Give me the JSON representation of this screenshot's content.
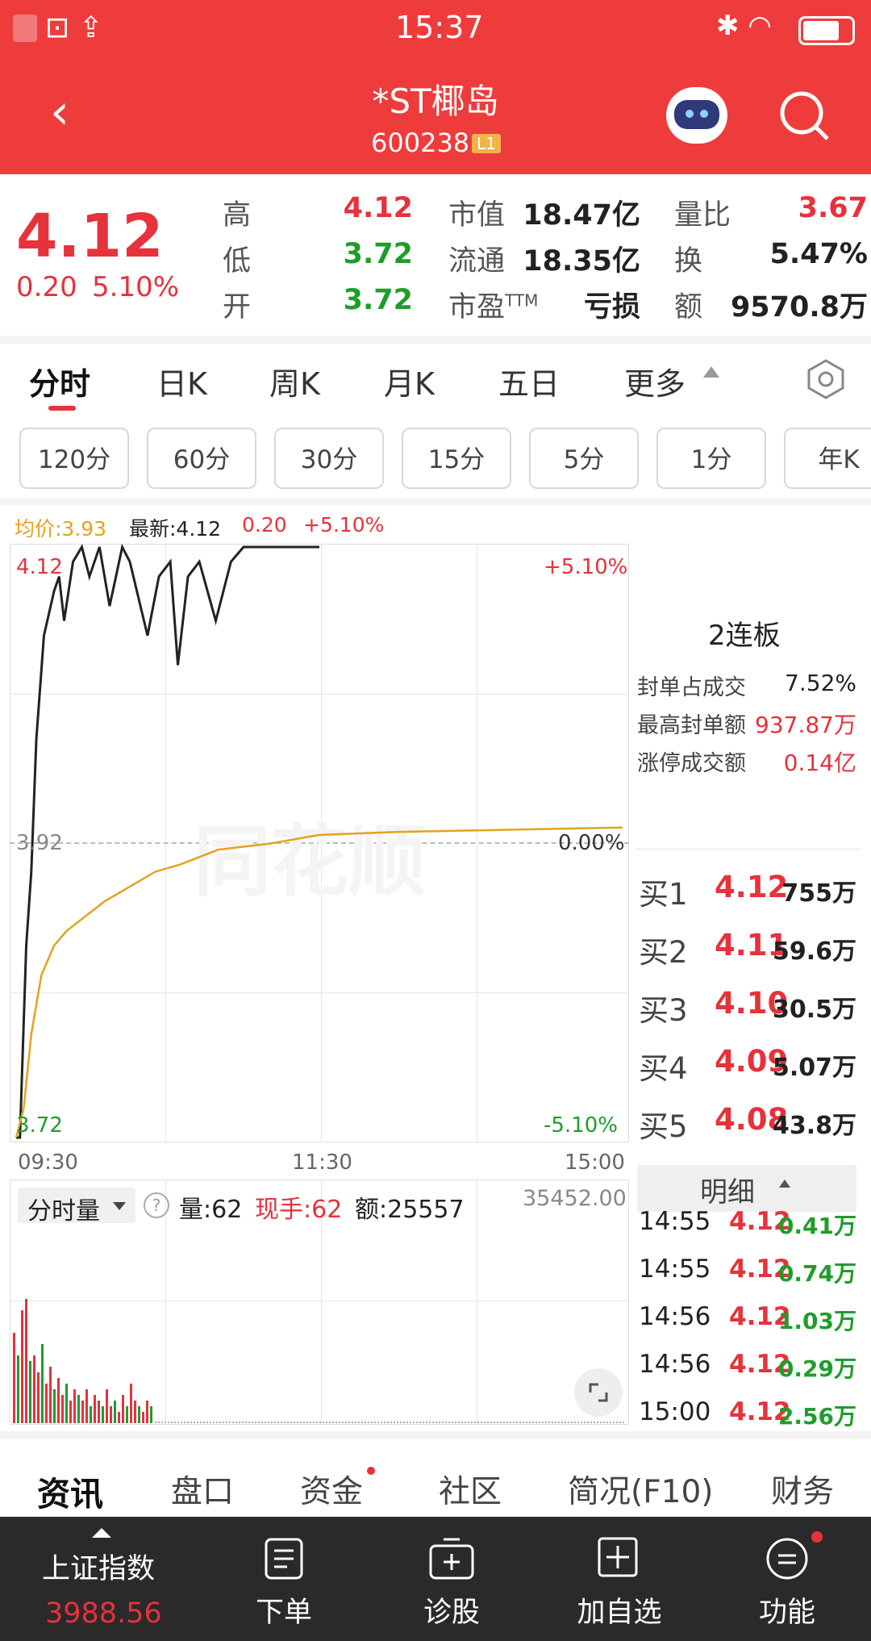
{
  "status": {
    "time": "15:37"
  },
  "header": {
    "stock_name": "*ST椰岛",
    "stock_code": "600238",
    "level_badge": "L1"
  },
  "quote": {
    "price": "4.12",
    "change": "0.20",
    "change_pct": "5.10%",
    "rows": [
      [
        {
          "l": "高",
          "v": "4.12",
          "c": "red"
        },
        {
          "l": "市值",
          "v": "18.47亿"
        },
        {
          "l": "量比",
          "v": "3.67",
          "c": "red"
        }
      ],
      [
        {
          "l": "低",
          "v": "3.72",
          "c": "green"
        },
        {
          "l": "流通",
          "v": "18.35亿"
        },
        {
          "l": "换",
          "v": "5.47%"
        }
      ],
      [
        {
          "l": "开",
          "v": "3.72",
          "c": "green"
        },
        {
          "l": "市盈TTM",
          "v": "亏损"
        },
        {
          "l": "额",
          "v": "9570.8万"
        }
      ]
    ]
  },
  "tabs": [
    "分时",
    "日K",
    "周K",
    "月K",
    "五日",
    "更多"
  ],
  "chips": [
    "120分",
    "60分",
    "30分",
    "15分",
    "5分",
    "1分",
    "年K"
  ],
  "info_line": {
    "avg": "均价:3.93",
    "latest": "最新:4.12",
    "chg": "0.20",
    "pct": "+5.10%"
  },
  "chart_data": {
    "type": "line",
    "x_ticks": [
      "09:30",
      "11:30",
      "15:00"
    ],
    "y_left": {
      "top": "4.12",
      "mid": "3.92",
      "bottom": "3.72"
    },
    "y_right": {
      "top": "+5.10%",
      "mid": "0.00%",
      "bottom": "-5.10%"
    },
    "ylim": [
      3.72,
      4.12
    ],
    "series": [
      {
        "name": "最新",
        "color": "#222222",
        "points": [
          [
            0,
            3.72
          ],
          [
            3,
            3.72
          ],
          [
            8,
            3.85
          ],
          [
            12,
            3.9
          ],
          [
            16,
            3.99
          ],
          [
            22,
            4.06
          ],
          [
            30,
            4.09
          ],
          [
            34,
            4.1
          ],
          [
            38,
            4.07
          ],
          [
            45,
            4.11
          ],
          [
            52,
            4.12
          ],
          [
            58,
            4.1
          ],
          [
            66,
            4.12
          ],
          [
            74,
            4.08
          ],
          [
            84,
            4.12
          ],
          [
            90,
            4.11
          ],
          [
            104,
            4.06
          ],
          [
            113,
            4.1
          ],
          [
            122,
            4.11
          ],
          [
            128,
            4.04
          ],
          [
            136,
            4.1
          ],
          [
            145,
            4.11
          ],
          [
            158,
            4.07
          ],
          [
            170,
            4.11
          ],
          [
            180,
            4.12
          ],
          [
            190,
            4.12
          ],
          [
            240,
            4.12
          ]
        ]
      },
      {
        "name": "均价",
        "color": "#e5a21d",
        "points": [
          [
            0,
            3.72
          ],
          [
            6,
            3.74
          ],
          [
            12,
            3.79
          ],
          [
            20,
            3.83
          ],
          [
            30,
            3.85
          ],
          [
            40,
            3.86
          ],
          [
            55,
            3.87
          ],
          [
            70,
            3.88
          ],
          [
            90,
            3.89
          ],
          [
            110,
            3.9
          ],
          [
            130,
            3.905
          ],
          [
            160,
            3.915
          ],
          [
            200,
            3.919
          ],
          [
            240,
            3.925
          ],
          [
            300,
            3.927
          ],
          [
            360,
            3.928
          ],
          [
            420,
            3.929
          ],
          [
            480,
            3.93
          ]
        ]
      }
    ],
    "total_minutes": 480
  },
  "right_panel": {
    "board": "2连板",
    "stats": [
      {
        "l": "封单占成交",
        "v": "7.52%",
        "c": "dark"
      },
      {
        "l": "最高封单额",
        "v": "937.87万",
        "c": "red"
      },
      {
        "l": "涨停成交额",
        "v": "0.14亿",
        "c": "red"
      }
    ],
    "bids": [
      {
        "l": "买1",
        "p": "4.12",
        "q": "755万"
      },
      {
        "l": "买2",
        "p": "4.11",
        "q": "59.6万"
      },
      {
        "l": "买3",
        "p": "4.10",
        "q": "30.5万"
      },
      {
        "l": "买4",
        "p": "4.09",
        "q": "5.07万"
      },
      {
        "l": "买5",
        "p": "4.08",
        "q": "43.8万"
      }
    ],
    "detail_label": "明细",
    "trades": [
      {
        "t": "14:55",
        "p": "4.12",
        "v": "0.41万"
      },
      {
        "t": "14:55",
        "p": "4.12",
        "v": "0.74万"
      },
      {
        "t": "14:56",
        "p": "4.12",
        "v": "1.03万"
      },
      {
        "t": "14:56",
        "p": "4.12",
        "v": "0.29万"
      },
      {
        "t": "15:00",
        "p": "4.12",
        "v": "2.56万"
      }
    ]
  },
  "volume": {
    "label": "分时量",
    "qty": "量:62",
    "hand": "现手:62",
    "amt": "额:25557",
    "max": "35452.00",
    "bars": [
      [
        0,
        16
      ],
      [
        1,
        12
      ],
      [
        2,
        20
      ],
      [
        3,
        22
      ],
      [
        4,
        11
      ],
      [
        5,
        12
      ],
      [
        6,
        9
      ],
      [
        7,
        14
      ],
      [
        8,
        7
      ],
      [
        9,
        10
      ],
      [
        10,
        6
      ],
      [
        11,
        8
      ],
      [
        12,
        5
      ],
      [
        13,
        7
      ],
      [
        14,
        4
      ],
      [
        15,
        6
      ],
      [
        16,
        5
      ],
      [
        17,
        4
      ],
      [
        18,
        6
      ],
      [
        19,
        3
      ],
      [
        20,
        5
      ],
      [
        21,
        4
      ],
      [
        22,
        3
      ],
      [
        23,
        6
      ],
      [
        24,
        3
      ],
      [
        25,
        4
      ],
      [
        26,
        2
      ],
      [
        27,
        5
      ],
      [
        28,
        3
      ],
      [
        29,
        7
      ],
      [
        30,
        4
      ],
      [
        31,
        3
      ],
      [
        32,
        2
      ],
      [
        33,
        4
      ],
      [
        34,
        3
      ]
    ]
  },
  "bottom_tabs": [
    "资讯",
    "盘口",
    "资金",
    "社区",
    "简况(F10)",
    "财务"
  ],
  "nav": {
    "index_name": "上证指数",
    "index_value": "3988.56",
    "items": [
      "下单",
      "诊股",
      "加自选",
      "功能"
    ]
  },
  "colors": {
    "header": "#ee3c3c",
    "up": "#e5323b",
    "down": "#1f9d2b",
    "avg_line": "#e5a21d"
  }
}
